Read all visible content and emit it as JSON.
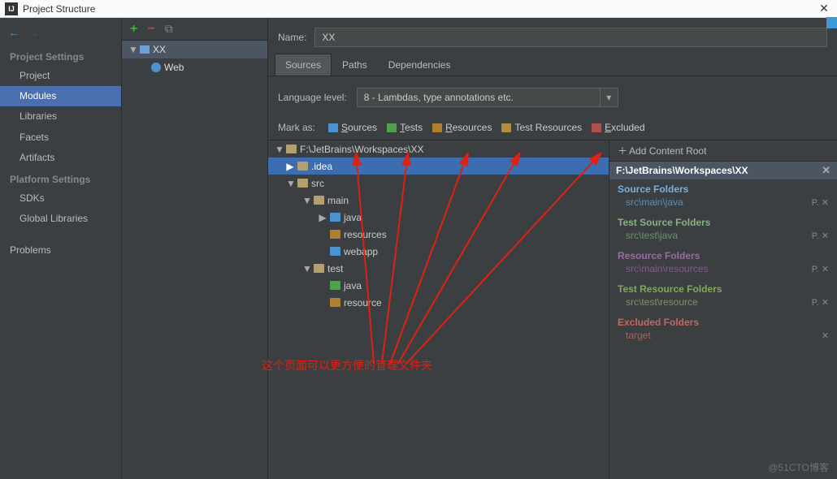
{
  "titlebar": {
    "title": "Project Structure"
  },
  "sidebar": {
    "headings": {
      "project": "Project Settings",
      "platform": "Platform Settings"
    },
    "project_items": [
      "Project",
      "Modules",
      "Libraries",
      "Facets",
      "Artifacts"
    ],
    "platform_items": [
      "SDKs",
      "Global Libraries"
    ],
    "problems": "Problems"
  },
  "tree": {
    "root": "XX",
    "sub": "Web"
  },
  "main": {
    "name_label": "Name:",
    "name_value": "XX",
    "tabs": [
      "Sources",
      "Paths",
      "Dependencies"
    ],
    "lang_label": "Language level:",
    "lang_value": "8 - Lambdas, type annotations etc.",
    "mark_label": "Mark as:",
    "marks": {
      "sources": "Sources",
      "tests": "Tests",
      "resources": "Resources",
      "test_resources": "Test Resources",
      "excluded": "Excluded"
    }
  },
  "filetree": {
    "root": "F:\\JetBrains\\Workspaces\\XX",
    "idea": ".idea",
    "src": "src",
    "main": "main",
    "java_main": "java",
    "resources_main": "resources",
    "webapp": "webapp",
    "test": "test",
    "java_test": "java",
    "resource_test": "resource"
  },
  "right": {
    "add_root": "Add Content Root",
    "root_path": "F:\\JetBrains\\Workspaces\\XX",
    "cats": {
      "source": "Source Folders",
      "testsource": "Test Source Folders",
      "resource": "Resource Folders",
      "testresource": "Test Resource Folders",
      "excluded": "Excluded Folders"
    },
    "paths": {
      "source": "src\\main\\java",
      "testsource": "src\\test\\java",
      "resource": "src\\main\\resources",
      "testresource": "src\\test\\resource",
      "excluded": "target"
    }
  },
  "annotation": "这个页面可以更方便的管理文件夹",
  "watermark": "@51CTO博客"
}
